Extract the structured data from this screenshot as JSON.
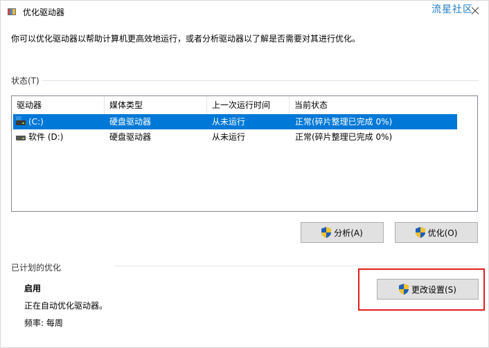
{
  "window": {
    "title": "优化驱动器",
    "watermark": "流星社区"
  },
  "description": "你可以优化驱动器以帮助计算机更高效地运行，或者分析驱动器以了解是否需要对其进行优化。",
  "status_section": {
    "label": "状态(T)",
    "columns": [
      "驱动器",
      "媒体类型",
      "上一次运行时间",
      "当前状态"
    ],
    "rows": [
      {
        "drive": "(C:)",
        "media": "硬盘驱动器",
        "last_run": "从未运行",
        "status": "正常(碎片整理已完成 0%)",
        "icon": "system-drive-icon",
        "selected": true
      },
      {
        "drive": "软件 (D:)",
        "media": "硬盘驱动器",
        "last_run": "从未运行",
        "status": "正常(碎片整理已完成 0%)",
        "icon": "drive-icon",
        "selected": false
      }
    ]
  },
  "buttons": {
    "analyze": "分析(A)",
    "optimize": "优化(O)",
    "change_settings": "更改设置(S)"
  },
  "scheduled": {
    "label": "已计划的优化",
    "state": "启用",
    "status": "正在自动优化驱动器。",
    "frequency": "频率: 每周"
  },
  "colors": {
    "selection": "#0078d7",
    "highlight_box": "#e21c1c",
    "watermark": "#1f7cc7"
  }
}
